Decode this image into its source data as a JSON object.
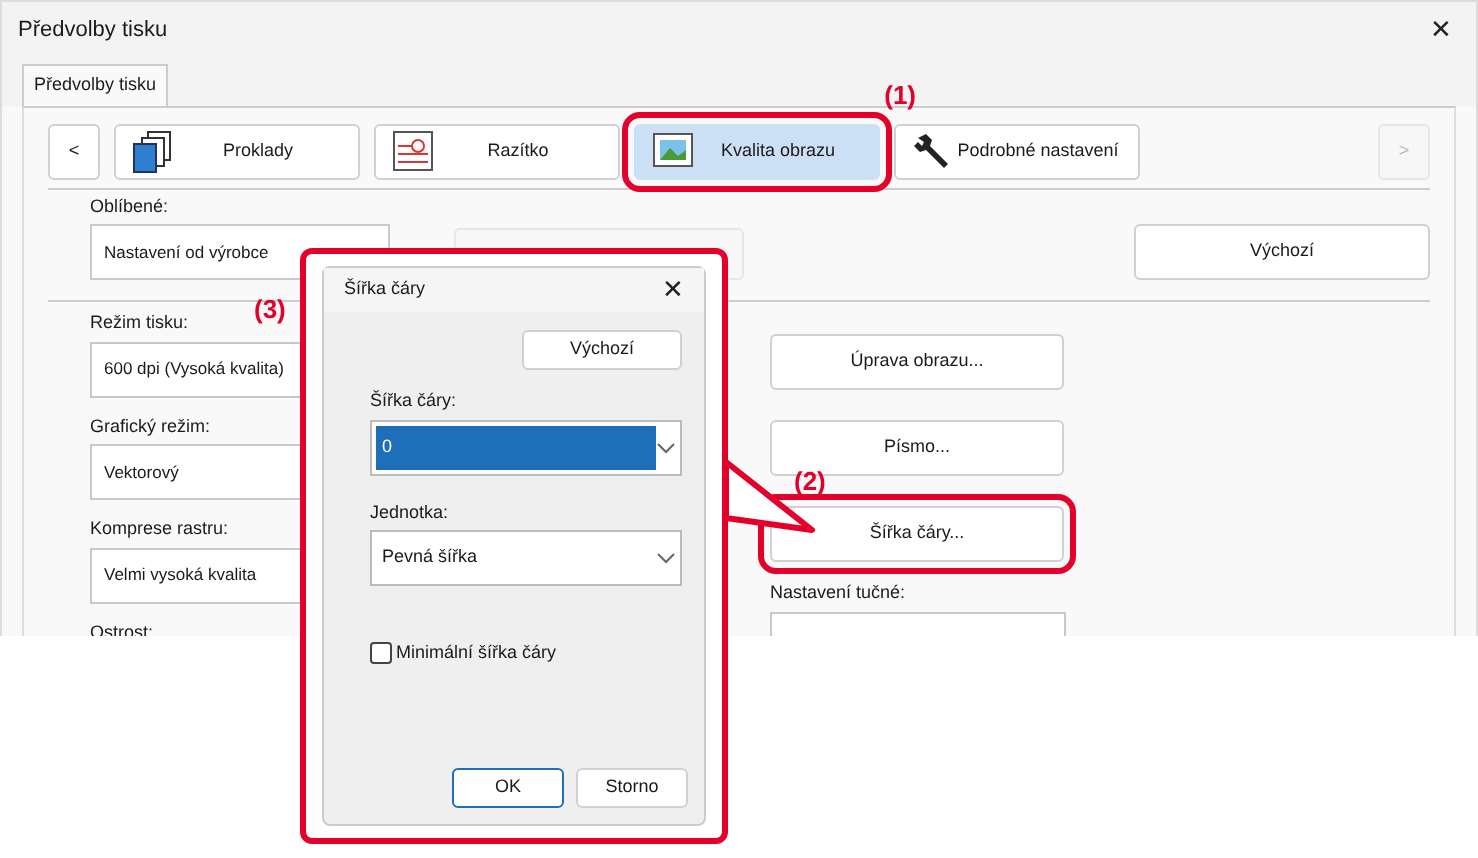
{
  "window": {
    "title": "Předvolby tisku",
    "close": "✕"
  },
  "tabs": [
    {
      "label": "Předvolby tisku",
      "selected": true
    }
  ],
  "toolbar": {
    "prev": "<",
    "next": ">",
    "next_disabled": true,
    "items": [
      {
        "label": "Proklady",
        "selected": false
      },
      {
        "label": "Razítko",
        "selected": false
      },
      {
        "label": "Kvalita obrazu",
        "selected": true,
        "annotation": "(1)"
      },
      {
        "label": "Podrobné nastavení",
        "selected": false
      }
    ]
  },
  "favorites": {
    "label": "Oblíbené:",
    "value": "Nastavení od výrobce"
  },
  "default_button": "Výchozí",
  "left_fields": [
    {
      "label": "Režim tisku:",
      "value": "600 dpi (Vysoká kvalita)"
    },
    {
      "label": "Grafický režim:",
      "value": "Vektorový"
    },
    {
      "label": "Komprese rastru:",
      "value": "Velmi vysoká kvalita"
    },
    {
      "label": "Ostrost:"
    }
  ],
  "right_buttons": [
    {
      "label": "Úprava obrazu...",
      "highlighted": false
    },
    {
      "label": "Písmo...",
      "highlighted": false
    },
    {
      "label": "Šířka čáry...",
      "highlighted": true,
      "annotation": "(2)"
    }
  ],
  "bold_setting": {
    "label": "Nastavení tučné:"
  },
  "dialog": {
    "title": "Šířka čáry",
    "close": "✕",
    "annotation": "(3)",
    "default_button": "Výchozí",
    "fields": [
      {
        "label": "Šířka čáry:",
        "value": "0",
        "value_selected": true
      },
      {
        "label": "Jednotka:",
        "value": "Pevná šířka",
        "value_selected": false
      }
    ],
    "checkbox": {
      "label": "Minimální šířka čáry",
      "checked": false
    },
    "buttons": [
      {
        "label": "OK",
        "default": true
      },
      {
        "label": "Storno",
        "default": false
      }
    ]
  }
}
